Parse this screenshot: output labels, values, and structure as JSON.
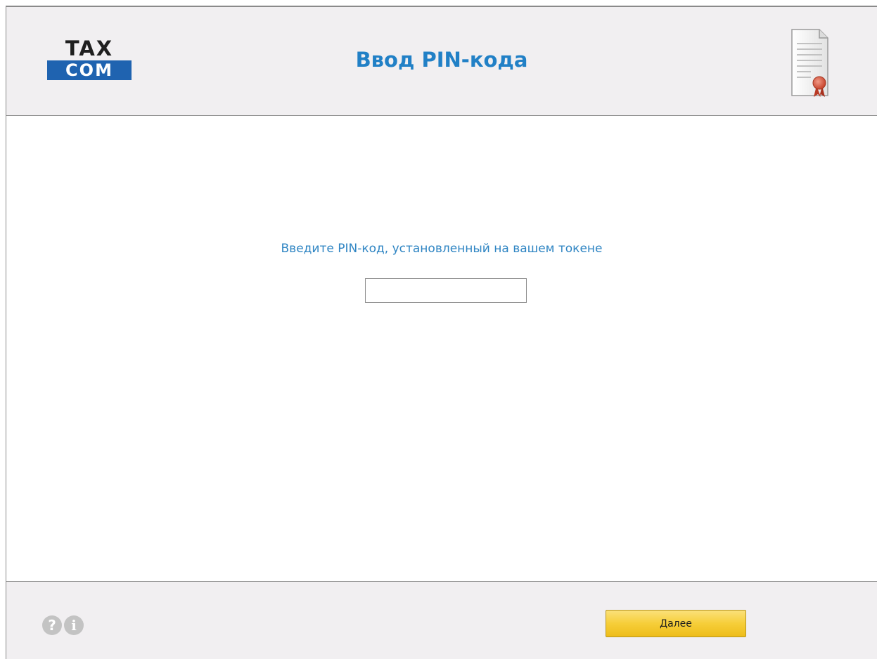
{
  "header": {
    "logo": {
      "line1": "TAX",
      "line2": "COM"
    },
    "title": "Ввод PIN-кода",
    "icon": "certificate-icon"
  },
  "main": {
    "prompt": "Введите PIN-код, установленный на вашем токене",
    "pin_value": ""
  },
  "footer": {
    "help_icon": "help-icon",
    "help_glyph": "?",
    "info_icon": "info-icon",
    "info_glyph": "i",
    "next_label": "Далее"
  },
  "colors": {
    "accent_blue": "#2180c6",
    "logo_blue": "#1f63b0",
    "button_yellow": "#f6ce39",
    "panel_gray": "#f1eff1"
  }
}
